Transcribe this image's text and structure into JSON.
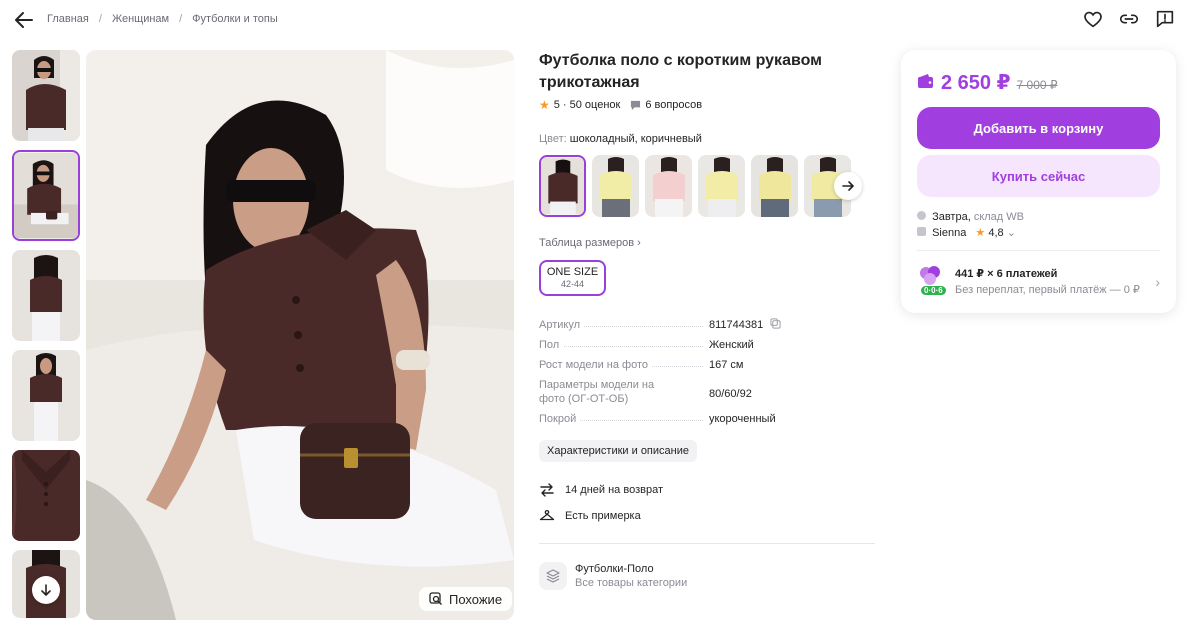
{
  "header": {
    "breadcrumbs": [
      "Главная",
      "Женщинам",
      "Футболки и топы"
    ],
    "separator": "/"
  },
  "gallery": {
    "thumb_count": 6,
    "active_index": 1,
    "similar_label": "Похожие"
  },
  "product": {
    "title": "Футболка поло с коротким рукавом трикотажная",
    "rating": "5",
    "reviews": "· 50 оценок",
    "questions": "6 вопросов",
    "color_label": "Цвет:",
    "color_value": "шоколадный, коричневый",
    "size_table_label": "Таблица размеров",
    "size": {
      "name": "ONE SIZE",
      "range": "42-44"
    },
    "specs": [
      {
        "key": "Артикул",
        "value": "811744381"
      },
      {
        "key": "Пол",
        "value": "Женский"
      },
      {
        "key": "Рост модели на фото",
        "value": "167 см"
      },
      {
        "key": "Параметры модели на фото (ОГ-ОТ-ОБ)",
        "value": "80/60/92"
      },
      {
        "key": "Покрой",
        "value": "укороченный"
      }
    ],
    "description_button": "Характеристики и описание",
    "features": [
      {
        "label": "14 дней на возврат",
        "icon": "return-arrows-icon"
      },
      {
        "label": "Есть примерка",
        "icon": "hanger-icon"
      }
    ],
    "category": {
      "name": "Футболки-Поло",
      "sub": "Все товары категории"
    }
  },
  "card": {
    "price": "2 650 ₽",
    "old_price": "7 000 ₽",
    "add_to_cart": "Добавить в корзину",
    "buy_now": "Купить сейчас",
    "delivery_when": "Завтра,",
    "delivery_where": "склад WB",
    "seller": "Sienna",
    "seller_rating": "4,8",
    "installment_title": "441 ₽ × 6 платежей",
    "installment_sub": "Без переплат, первый платёж — 0 ₽",
    "installment_badge": "0·0·6"
  },
  "colors": {
    "accent": "#a13ee0",
    "accent_light": "#f6e6fd",
    "star": "#f59a24",
    "shirt": "#4a2a28"
  }
}
